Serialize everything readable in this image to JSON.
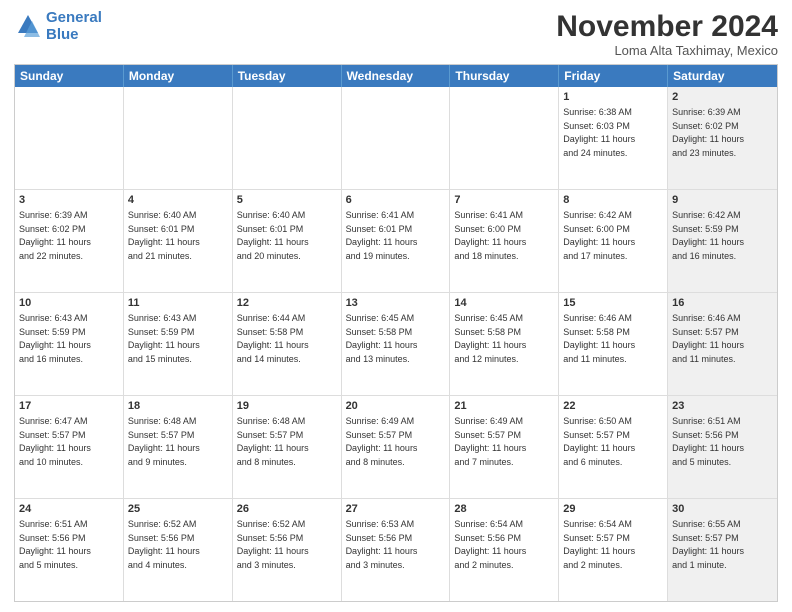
{
  "logo": {
    "line1": "General",
    "line2": "Blue"
  },
  "title": "November 2024",
  "location": "Loma Alta Taxhimay, Mexico",
  "days_of_week": [
    "Sunday",
    "Monday",
    "Tuesday",
    "Wednesday",
    "Thursday",
    "Friday",
    "Saturday"
  ],
  "weeks": [
    [
      {
        "day": "",
        "info": "",
        "shaded": false
      },
      {
        "day": "",
        "info": "",
        "shaded": false
      },
      {
        "day": "",
        "info": "",
        "shaded": false
      },
      {
        "day": "",
        "info": "",
        "shaded": false
      },
      {
        "day": "",
        "info": "",
        "shaded": false
      },
      {
        "day": "1",
        "info": "Sunrise: 6:38 AM\nSunset: 6:03 PM\nDaylight: 11 hours\nand 24 minutes.",
        "shaded": false
      },
      {
        "day": "2",
        "info": "Sunrise: 6:39 AM\nSunset: 6:02 PM\nDaylight: 11 hours\nand 23 minutes.",
        "shaded": true
      }
    ],
    [
      {
        "day": "3",
        "info": "Sunrise: 6:39 AM\nSunset: 6:02 PM\nDaylight: 11 hours\nand 22 minutes.",
        "shaded": false
      },
      {
        "day": "4",
        "info": "Sunrise: 6:40 AM\nSunset: 6:01 PM\nDaylight: 11 hours\nand 21 minutes.",
        "shaded": false
      },
      {
        "day": "5",
        "info": "Sunrise: 6:40 AM\nSunset: 6:01 PM\nDaylight: 11 hours\nand 20 minutes.",
        "shaded": false
      },
      {
        "day": "6",
        "info": "Sunrise: 6:41 AM\nSunset: 6:01 PM\nDaylight: 11 hours\nand 19 minutes.",
        "shaded": false
      },
      {
        "day": "7",
        "info": "Sunrise: 6:41 AM\nSunset: 6:00 PM\nDaylight: 11 hours\nand 18 minutes.",
        "shaded": false
      },
      {
        "day": "8",
        "info": "Sunrise: 6:42 AM\nSunset: 6:00 PM\nDaylight: 11 hours\nand 17 minutes.",
        "shaded": false
      },
      {
        "day": "9",
        "info": "Sunrise: 6:42 AM\nSunset: 5:59 PM\nDaylight: 11 hours\nand 16 minutes.",
        "shaded": true
      }
    ],
    [
      {
        "day": "10",
        "info": "Sunrise: 6:43 AM\nSunset: 5:59 PM\nDaylight: 11 hours\nand 16 minutes.",
        "shaded": false
      },
      {
        "day": "11",
        "info": "Sunrise: 6:43 AM\nSunset: 5:59 PM\nDaylight: 11 hours\nand 15 minutes.",
        "shaded": false
      },
      {
        "day": "12",
        "info": "Sunrise: 6:44 AM\nSunset: 5:58 PM\nDaylight: 11 hours\nand 14 minutes.",
        "shaded": false
      },
      {
        "day": "13",
        "info": "Sunrise: 6:45 AM\nSunset: 5:58 PM\nDaylight: 11 hours\nand 13 minutes.",
        "shaded": false
      },
      {
        "day": "14",
        "info": "Sunrise: 6:45 AM\nSunset: 5:58 PM\nDaylight: 11 hours\nand 12 minutes.",
        "shaded": false
      },
      {
        "day": "15",
        "info": "Sunrise: 6:46 AM\nSunset: 5:58 PM\nDaylight: 11 hours\nand 11 minutes.",
        "shaded": false
      },
      {
        "day": "16",
        "info": "Sunrise: 6:46 AM\nSunset: 5:57 PM\nDaylight: 11 hours\nand 11 minutes.",
        "shaded": true
      }
    ],
    [
      {
        "day": "17",
        "info": "Sunrise: 6:47 AM\nSunset: 5:57 PM\nDaylight: 11 hours\nand 10 minutes.",
        "shaded": false
      },
      {
        "day": "18",
        "info": "Sunrise: 6:48 AM\nSunset: 5:57 PM\nDaylight: 11 hours\nand 9 minutes.",
        "shaded": false
      },
      {
        "day": "19",
        "info": "Sunrise: 6:48 AM\nSunset: 5:57 PM\nDaylight: 11 hours\nand 8 minutes.",
        "shaded": false
      },
      {
        "day": "20",
        "info": "Sunrise: 6:49 AM\nSunset: 5:57 PM\nDaylight: 11 hours\nand 8 minutes.",
        "shaded": false
      },
      {
        "day": "21",
        "info": "Sunrise: 6:49 AM\nSunset: 5:57 PM\nDaylight: 11 hours\nand 7 minutes.",
        "shaded": false
      },
      {
        "day": "22",
        "info": "Sunrise: 6:50 AM\nSunset: 5:57 PM\nDaylight: 11 hours\nand 6 minutes.",
        "shaded": false
      },
      {
        "day": "23",
        "info": "Sunrise: 6:51 AM\nSunset: 5:56 PM\nDaylight: 11 hours\nand 5 minutes.",
        "shaded": true
      }
    ],
    [
      {
        "day": "24",
        "info": "Sunrise: 6:51 AM\nSunset: 5:56 PM\nDaylight: 11 hours\nand 5 minutes.",
        "shaded": false
      },
      {
        "day": "25",
        "info": "Sunrise: 6:52 AM\nSunset: 5:56 PM\nDaylight: 11 hours\nand 4 minutes.",
        "shaded": false
      },
      {
        "day": "26",
        "info": "Sunrise: 6:52 AM\nSunset: 5:56 PM\nDaylight: 11 hours\nand 3 minutes.",
        "shaded": false
      },
      {
        "day": "27",
        "info": "Sunrise: 6:53 AM\nSunset: 5:56 PM\nDaylight: 11 hours\nand 3 minutes.",
        "shaded": false
      },
      {
        "day": "28",
        "info": "Sunrise: 6:54 AM\nSunset: 5:56 PM\nDaylight: 11 hours\nand 2 minutes.",
        "shaded": false
      },
      {
        "day": "29",
        "info": "Sunrise: 6:54 AM\nSunset: 5:57 PM\nDaylight: 11 hours\nand 2 minutes.",
        "shaded": false
      },
      {
        "day": "30",
        "info": "Sunrise: 6:55 AM\nSunset: 5:57 PM\nDaylight: 11 hours\nand 1 minute.",
        "shaded": true
      }
    ]
  ]
}
